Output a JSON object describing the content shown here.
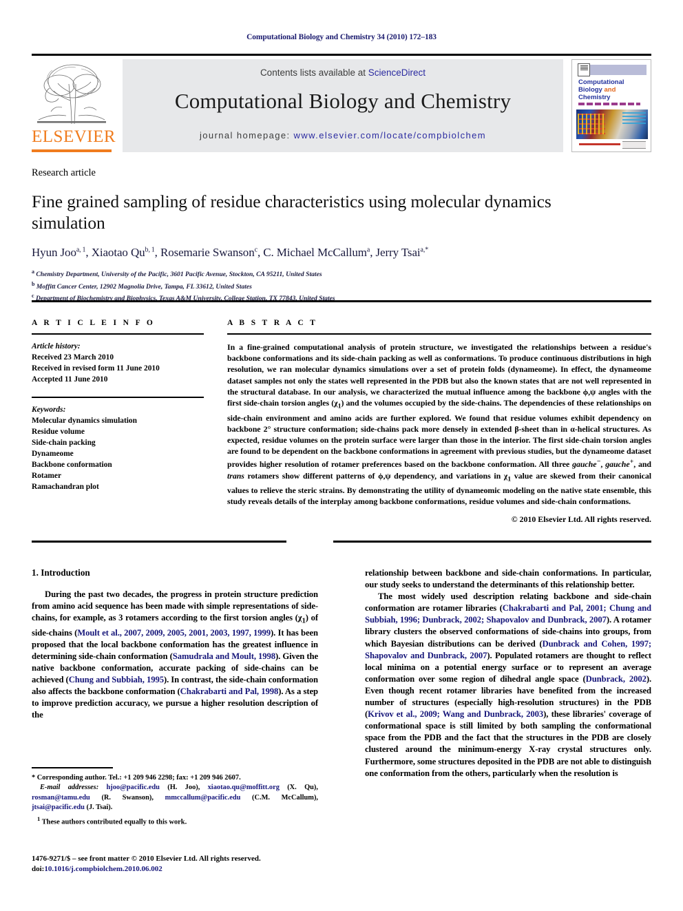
{
  "running_head": "Computational Biology and Chemistry 34 (2010) 172–183",
  "masthead": {
    "contents_prefix": "Contents lists available at ",
    "sciencedirect": "ScienceDirect",
    "journal_title": "Computational Biology and Chemistry",
    "homepage_label": "journal homepage:",
    "homepage_url": "www.elsevier.com/locate/compbiolchem",
    "publisher": "ELSEVIER",
    "cover": {
      "line1": "Computational",
      "line2a": "Biology ",
      "line2b": "and",
      "line3": "Chemistry"
    }
  },
  "article": {
    "kind": "Research article",
    "title": "Fine grained sampling of residue characteristics using molecular dynamics simulation",
    "authors_html": "Hyun Joo<sup>a, 1</sup>, Xiaotao Qu<sup>b, 1</sup>, Rosemarie Swanson<sup>c</sup>, C. Michael McCallum<sup>a</sup>, Jerry Tsai<sup>a,</sup><sup>*</sup>",
    "affiliations": [
      "Chemistry Department, University of the Pacific, 3601 Pacific Avenue, Stockton, CA 95211, United States",
      "Moffitt Cancer Center, 12902 Magnolia Drive, Tampa, FL 33612, United States",
      "Department of Biochemistry and Biophysics, Texas A&M University, College Station, TX 77843, United States"
    ],
    "affiliation_marks": [
      "a",
      "b",
      "c"
    ]
  },
  "article_info": {
    "heading": "A R T I C L E   I N F O",
    "history_label": "Article history:",
    "history": [
      "Received 23 March 2010",
      "Received in revised form 11 June 2010",
      "Accepted 11 June 2010"
    ],
    "keywords_label": "Keywords:",
    "keywords": [
      "Molecular dynamics simulation",
      "Residue volume",
      "Side-chain packing",
      "Dynameome",
      "Backbone conformation",
      "Rotamer",
      "Ramachandran plot"
    ]
  },
  "abstract": {
    "heading": "A B S T R A C T",
    "body_html": "In a fine-grained computational analysis of protein structure, we investigated the relationships between a residue's backbone conformations and its side-chain packing as well as conformations. To produce continuous distributions in high resolution, we ran molecular dynamics simulations over a set of protein folds (dynameome). In effect, the dynameome dataset samples not only the states well represented in the PDB but also the known states that are not well represented in the structural database. In our analysis, we characterized the mutual influence among the backbone &#981;,&#968; angles with the first side-chain torsion angles (&#967;<sub>1</sub>) and the volumes occupied by the side-chains. The dependencies of these relationships on side-chain environment and amino acids are further explored. We found that residue volumes exhibit dependency on backbone 2&#176; structure conformation; side-chains pack more densely in extended &#946;-sheet than in &#945;-helical structures. As expected, residue volumes on the protein surface were larger than those in the interior. The first side-chain torsion angles are found to be dependent on the backbone conformations in agreement with previous studies, but the dynameome dataset provides higher resolution of rotamer preferences based on the backbone conformation. All three <span class=\"ital\">gauche<sup>&#8722;</sup></span>, <span class=\"ital\">gauche<sup>+</sup></span>, and <span class=\"ital\">trans</span> rotamers show different patterns of &#981;,&#968; dependency, and variations in &#967;<sub>1</sub> value are skewed from their canonical values to relieve the steric strains. By demonstrating the utility of dynameomic modeling on the native state ensemble, this study reveals details of the interplay among backbone conformations, residue volumes and side-chain conformations.",
    "copyright": "© 2010 Elsevier Ltd. All rights reserved."
  },
  "introduction": {
    "heading": "1.  Introduction",
    "left_paragraphs_html": [
      "During the past two decades, the progress in protein structure prediction from amino acid sequence has been made with simple representations of side-chains, for example, as 3 rotamers according to the first torsion angles (&#967;<sub>1</sub>) of side-chains (<span class=\"ref\">Moult et al., 2007, 2009, 2005, 2001, 2003, 1997, 1999</span>). It has been proposed that the local backbone conformation has the greatest influence in determining side-chain conformation (<span class=\"ref\">Samudrala and Moult, 1998</span>). Given the native backbone conformation, accurate packing of side-chains can be achieved (<span class=\"ref\">Chung and Subbiah, 1995</span>). In contrast, the side-chain conformation also affects the backbone conformation (<span class=\"ref\">Chakrabarti and Pal, 1998</span>). As a step to improve prediction accuracy, we pursue a higher resolution description of the"
    ],
    "right_paragraphs_html": [
      "relationship between backbone and side-chain conformations. In particular, our study seeks to understand the determinants of this relationship better.",
      "The most widely used description relating backbone and side-chain conformation are rotamer libraries (<span class=\"ref\">Chakrabarti and Pal, 2001; Chung and Subbiah, 1996; Dunbrack, 2002; Shapovalov and Dunbrack, 2007</span>). A rotamer library clusters the observed conformations of side-chains into groups, from which Bayesian distributions can be derived (<span class=\"ref\">Dunbrack and Cohen, 1997; Shapovalov and Dunbrack, 2007</span>). Populated rotamers are thought to reflect local minima on a potential energy surface or to represent an average conformation over some region of dihedral angle space (<span class=\"ref\">Dunbrack, 2002</span>). Even though recent rotamer libraries have benefited from the increased number of structures (especially high-resolution structures) in the PDB (<span class=\"ref\">Krivov et al., 2009; Wang and Dunbrack, 2003</span>), these libraries' coverage of conformational space is still limited by both sampling the conformational space from the PDB and the fact that the structures in the PDB are closely clustered around the minimum-energy X-ray crystal structures only. Furthermore, some structures deposited in the PDB are not able to distinguish one conformation from the others, particularly when the resolution is"
    ]
  },
  "footnotes": {
    "corresponding_html": "* Corresponding author. Tel.: +1 209 946 2298; fax: +1 209 946 2607.",
    "email_label": "E-mail addresses:",
    "emails_html": "<span class=\"fn-mail\">hjoo@pacific.edu</span> (H. Joo), <span class=\"fn-mail\">xiaotao.qu@moffitt.org</span> (X. Qu), <span class=\"fn-mail\">rosman@tamu.edu</span> (R. Swanson), <span class=\"fn-mail\">mmccallum@pacific.edu</span> (C.M. McCallum), <span class=\"fn-mail\">jtsai@pacific.edu</span> (J. Tsai).",
    "equal_contrib_html": "<sup>1</sup>  These authors contributed equally to this work.",
    "issn_line": "1476-9271/$ – see front matter © 2010 Elsevier Ltd. All rights reserved.",
    "doi_label": "doi:",
    "doi_value": "10.1016/j.compbiolchem.2010.06.002"
  }
}
